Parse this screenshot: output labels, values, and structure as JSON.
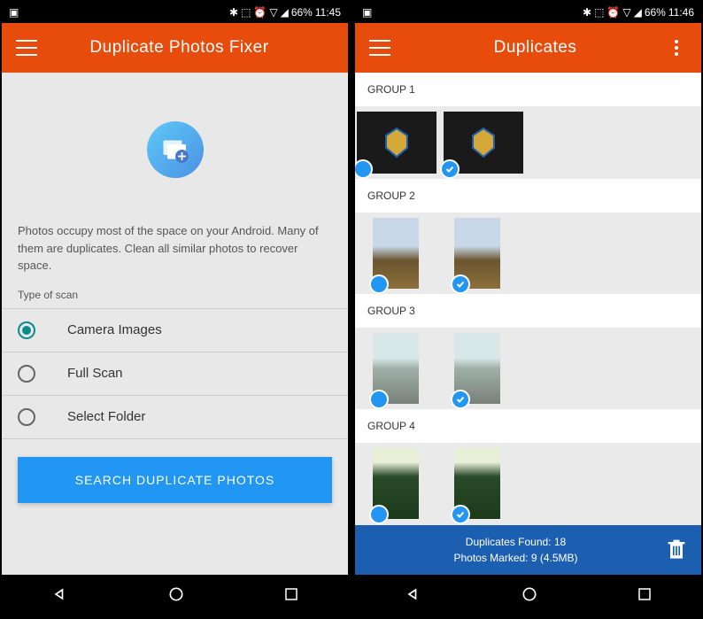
{
  "statusbar": {
    "battery": "66%",
    "time1": "11:45",
    "time2": "11:46"
  },
  "screen1": {
    "title": "Duplicate Photos Fixer",
    "description": "Photos occupy most of the space on your Android. Many of them are duplicates. Clean all similar photos to recover space.",
    "section_label": "Type of scan",
    "options": {
      "camera": "Camera Images",
      "full": "Full Scan",
      "folder": "Select Folder"
    },
    "search_button": "SEARCH DUPLICATE PHOTOS"
  },
  "screen2": {
    "title": "Duplicates",
    "groups": {
      "g1": "GROUP 1",
      "g2": "GROUP 2",
      "g3": "GROUP 3",
      "g4": "GROUP 4"
    },
    "bottom": {
      "found": "Duplicates Found: 18",
      "marked": "Photos Marked: 9 (4.5MB)"
    }
  }
}
